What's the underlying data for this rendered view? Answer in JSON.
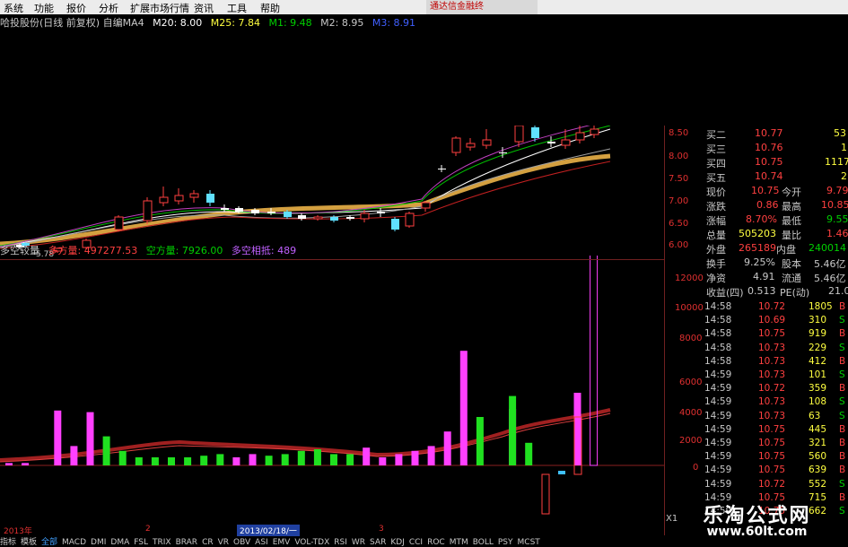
{
  "menu": {
    "items": [
      "系统",
      "功能",
      "报价",
      "分析",
      "扩展市场行情",
      "资讯",
      "工具",
      "帮助"
    ],
    "ad": "通达信金融终"
  },
  "ma_line": {
    "title": "哈投股份(日线 前复权) 自编MA4",
    "items": [
      {
        "text": "M20: 8.00",
        "color": "#ffffff"
      },
      {
        "text": "M25: 7.84",
        "color": "#ffff40"
      },
      {
        "text": "M1: 9.48",
        "color": "#00d000"
      },
      {
        "text": "M2: 8.95",
        "color": "#c8c8c8"
      },
      {
        "text": "M3: 8.91",
        "color": "#4060ff"
      }
    ]
  },
  "kchart": {
    "low_label": "5.78",
    "y_ticks": [
      "8.50",
      "8.00",
      "7.50",
      "7.00",
      "6.50",
      "6.00"
    ]
  },
  "vol_line": {
    "title": "多空较量",
    "items": [
      {
        "text": "多方量: 497277.53",
        "color": "#ff4040"
      },
      {
        "text": "空方量: 7926.00",
        "color": "#00d000"
      },
      {
        "text": "多空相抵: 489",
        "color": "#c060ff"
      }
    ]
  },
  "vol_y_ticks": [
    "12000",
    "10000",
    "8000",
    "6000",
    "4000",
    "2000",
    "0"
  ],
  "chart_data": {
    "type": "bar",
    "title": "多空较量",
    "series": [
      {
        "name": "多方量",
        "color": "#ff40ff",
        "values": [
          150,
          150,
          0,
          3400,
          1200,
          3300,
          0,
          0,
          0,
          0,
          0,
          0,
          0,
          0,
          500,
          700,
          0,
          0,
          0,
          0,
          0,
          0,
          1100,
          500,
          700,
          900,
          1200,
          2100,
          7100,
          0,
          0,
          3500,
          0,
          0,
          0,
          4500,
          14000
        ]
      },
      {
        "name": "空方量",
        "color": "#20e020",
        "values": [
          0,
          0,
          0,
          0,
          0,
          0,
          1800,
          900,
          500,
          500,
          500,
          500,
          600,
          700,
          0,
          0,
          600,
          700,
          900,
          1000,
          700,
          700,
          0,
          0,
          0,
          0,
          0,
          0,
          0,
          3000,
          0,
          4300,
          1400,
          0,
          0,
          0,
          0
        ]
      }
    ],
    "ylim": [
      0,
      13000
    ]
  },
  "quote": {
    "bids": [
      {
        "label": "买二",
        "price": "10.77",
        "vol": "53"
      },
      {
        "label": "买三",
        "price": "10.76",
        "vol": "1"
      },
      {
        "label": "买四",
        "price": "10.75",
        "vol": "1117"
      },
      {
        "label": "买五",
        "price": "10.74",
        "vol": "2"
      }
    ],
    "stats": [
      {
        "l1": "现价",
        "v1": "10.75",
        "l2": "今开",
        "v2": "9.79"
      },
      {
        "l1": "涨跌",
        "v1": "0.86",
        "l2": "最高",
        "v2": "10.85"
      },
      {
        "l1": "涨幅",
        "v1": "8.70%",
        "l2": "最低",
        "v2": "9.55"
      },
      {
        "l1": "总量",
        "v1": "505203",
        "l2": "量比",
        "v2": "1.46"
      },
      {
        "l1": "外盘",
        "v1": "265189",
        "l2": "内盘",
        "v2": "240014"
      },
      {
        "l1": "换手",
        "v1": "9.25%",
        "l2": "股本",
        "v2": "5.46亿"
      },
      {
        "l1": "净资",
        "v1": "4.91",
        "l2": "流通",
        "v2": "5.46亿"
      },
      {
        "l1": "收益(四)",
        "v1": "0.513",
        "l2": "PE(动)",
        "v2": "21.0"
      }
    ]
  },
  "ticks": [
    {
      "t": "14:58",
      "p": "10.72",
      "v": "1805",
      "bs": "B"
    },
    {
      "t": "14:58",
      "p": "10.69",
      "v": "310",
      "bs": "S"
    },
    {
      "t": "14:58",
      "p": "10.75",
      "v": "919",
      "bs": "B"
    },
    {
      "t": "14:58",
      "p": "10.73",
      "v": "229",
      "bs": "S"
    },
    {
      "t": "14:58",
      "p": "10.73",
      "v": "412",
      "bs": "B"
    },
    {
      "t": "14:59",
      "p": "10.73",
      "v": "101",
      "bs": "S"
    },
    {
      "t": "14:59",
      "p": "10.72",
      "v": "359",
      "bs": "B"
    },
    {
      "t": "14:59",
      "p": "10.73",
      "v": "108",
      "bs": "S"
    },
    {
      "t": "14:59",
      "p": "10.73",
      "v": "63",
      "bs": "S"
    },
    {
      "t": "14:59",
      "p": "10.75",
      "v": "445",
      "bs": "B"
    },
    {
      "t": "14:59",
      "p": "10.75",
      "v": "321",
      "bs": "B"
    },
    {
      "t": "14:59",
      "p": "10.75",
      "v": "560",
      "bs": "B"
    },
    {
      "t": "14:59",
      "p": "10.75",
      "v": "639",
      "bs": "B"
    },
    {
      "t": "14:59",
      "p": "10.72",
      "v": "552",
      "bs": "S"
    },
    {
      "t": "14:59",
      "p": "10.75",
      "v": "715",
      "bs": "B"
    },
    {
      "t": "14:59",
      "p": "10.75",
      "v": "662",
      "bs": "S"
    }
  ],
  "timeaxis": {
    "year": "2013年",
    "m2": "2",
    "date": "2013/02/18/一",
    "m3": "3"
  },
  "tabs": [
    "指标",
    "模板",
    "全部",
    "MACD",
    "DMI",
    "DMA",
    "FSL",
    "TRIX",
    "BRAR",
    "CR",
    "VR",
    "OBV",
    "ASI",
    "EMV",
    "VOL-TDX",
    "RSI",
    "WR",
    "SAR",
    "KDJ",
    "CCI",
    "ROC",
    "MTM",
    "BOLL",
    "PSY",
    "MCST"
  ],
  "watermark": {
    "line1": "乐淘公式网",
    "line2": "www.60lt.com"
  },
  "x1_label": "X1"
}
